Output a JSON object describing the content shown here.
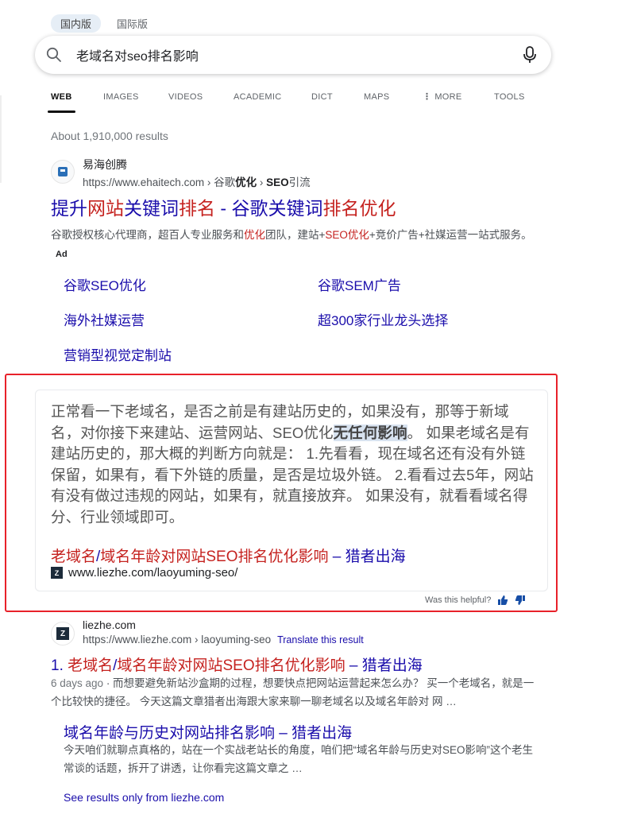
{
  "region": {
    "selected": "国内版",
    "other": "国际版"
  },
  "search": {
    "query": "老域名对seo排名影响"
  },
  "tabs": [
    {
      "label": "WEB",
      "active": true
    },
    {
      "label": "IMAGES"
    },
    {
      "label": "VIDEOS"
    },
    {
      "label": "ACADEMIC"
    },
    {
      "label": "DICT"
    },
    {
      "label": "MAPS"
    },
    {
      "label": "MORE",
      "icon": "vertical-dots-icon"
    },
    {
      "label": "TOOLS"
    }
  ],
  "results_count": "About 1,910,000 results",
  "ad": {
    "site_name": "易海创腾",
    "url_plain": "https://www.ehaitech.com › 谷歌",
    "url_bold1": "优化",
    "url_sep": " › ",
    "url_bold2": "SEO",
    "url_tail": "引流",
    "title_parts": [
      "提升",
      "网站",
      "关键词",
      "排名",
      " - 谷歌关键词",
      "排名优化"
    ],
    "desc_parts": [
      "谷歌授权核心代理商，超百人专业服务和",
      "优化",
      "团队，建站+",
      "SEO优化",
      "+竞价广告+社媒运营一站式服务。"
    ],
    "ad_tag": "Ad",
    "sitelinks": [
      "谷歌SEO优化",
      "谷歌SEM广告",
      "海外社媒运营",
      "超300家行业龙头选择",
      "营销型视觉定制站"
    ]
  },
  "answer": {
    "text_before": "正常看一下老域名，是否之前是有建站历史的，如果没有，那等于新域名，对你接下来建站、运营网站、SEO优化",
    "text_strong": "无任何影响",
    "text_after": "。 如果老域名是有建站历史的，那大概的判断方向就是： 1.先看看，现在域名还有没有外链保留，如果有，看下外链的质量，是否是垃圾外链。 2.看看过去5年，网站有没有做过违规的网站，如果有，就直接放弃。 如果没有，就看看域名得分、行业领域即可。",
    "link_parts": [
      "老域名",
      "/",
      "域名",
      "年龄",
      "对",
      "网站SEO排名优化",
      "影响",
      " – 猎者出海"
    ],
    "url": "www.liezhe.com/laoyuming-seo/",
    "helpful": "Was this helpful?"
  },
  "organic": {
    "site_name": "liezhe.com",
    "url": "https://www.liezhe.com › laoyuming-seo",
    "translate": "Translate this result",
    "title_parts": [
      "1. ",
      "老域名",
      "/",
      "域名",
      "年龄",
      "对",
      "网站SEO排名优化",
      "影响",
      " – 猎者出海"
    ],
    "date": "6 days ago",
    "desc": " · 而想要避免新站沙盒期的过程，想要快点把网站运营起来怎么办？ 买一个老域名，就是一个比较快的捷径。 今天这篇文章猎者出海跟大家来聊一聊老域名以及域名年龄对 网 …",
    "deep_title": "域名年龄与历史对网站排名影响 – 猎者出海",
    "deep_desc": "今天咱们就聊点真格的，站在一个实战老站长的角度，咱们把“域名年龄与历史对SEO影响”这个老生常谈的话题，拆开了讲透，让你看完这篇文章之 …",
    "see_only": "See results only from liezhe.com"
  }
}
